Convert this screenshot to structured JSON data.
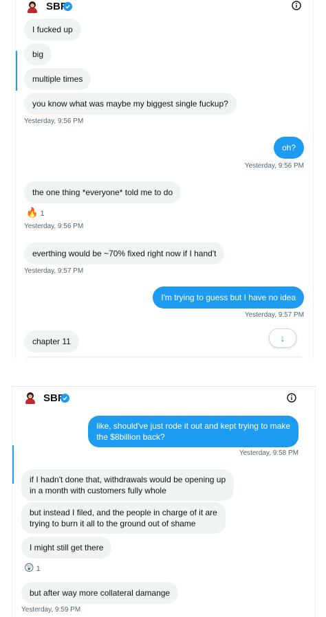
{
  "screenshot1": {
    "header": {
      "name": "SBF",
      "avatar": "avatar-icon",
      "verified": "verified-badge-icon",
      "info": "info-icon"
    },
    "messages": [
      {
        "dir": "in",
        "text": "I fucked up"
      },
      {
        "dir": "in",
        "text": "big"
      },
      {
        "dir": "in",
        "text": "multiple times"
      },
      {
        "dir": "in",
        "text": "you know what was maybe my biggest single fuckup?"
      },
      {
        "dir": "out",
        "text": "oh?"
      },
      {
        "dir": "in",
        "text": "the one thing *everyone* told me to do"
      },
      {
        "dir": "in",
        "text": "everthing would be ~70% fixed right now if I hand't"
      },
      {
        "dir": "out",
        "text": "I'm trying to guess but I have no idea"
      },
      {
        "dir": "in",
        "text": "chapter 11"
      }
    ],
    "timestamps": [
      "Yesterday, 9:56 PM",
      "Yesterday, 9:56 PM",
      "Yesterday, 9:56 PM",
      "Yesterday, 9:57 PM",
      "Yesterday, 9:57 PM"
    ],
    "reaction": {
      "emoji": "🔥",
      "count": "1"
    },
    "scroll_button_icon": "arrow-down-icon"
  },
  "screenshot2": {
    "header": {
      "name": "SBF",
      "avatar": "avatar-icon",
      "verified": "verified-badge-icon",
      "info": "info-icon"
    },
    "messages": [
      {
        "dir": "out",
        "lines": [
          "like, should've just rode it out and kept trying to make",
          "the $8billion back?"
        ]
      },
      {
        "dir": "in",
        "lines": [
          "if I hadn't done that, withdrawals would be opening up",
          "in a month with customers fully whole"
        ]
      },
      {
        "dir": "in",
        "lines": [
          "but instead I filed, and the people in charge of it are",
          "trying to burn it all to the ground out of shame"
        ]
      },
      {
        "dir": "in",
        "lines": [
          "I might still get there"
        ]
      },
      {
        "dir": "in",
        "lines": [
          "but after way more collateral damange"
        ]
      }
    ],
    "timestamps": [
      "Yesterday, 9:58 PM",
      "Yesterday, 9:59 PM"
    ],
    "reaction": {
      "emoji": "😲",
      "count": "1"
    }
  },
  "colors": {
    "accent": "#1d9bf0",
    "incoming_bubble": "#eff3f4",
    "text": "#0f1419",
    "muted": "#536471"
  }
}
